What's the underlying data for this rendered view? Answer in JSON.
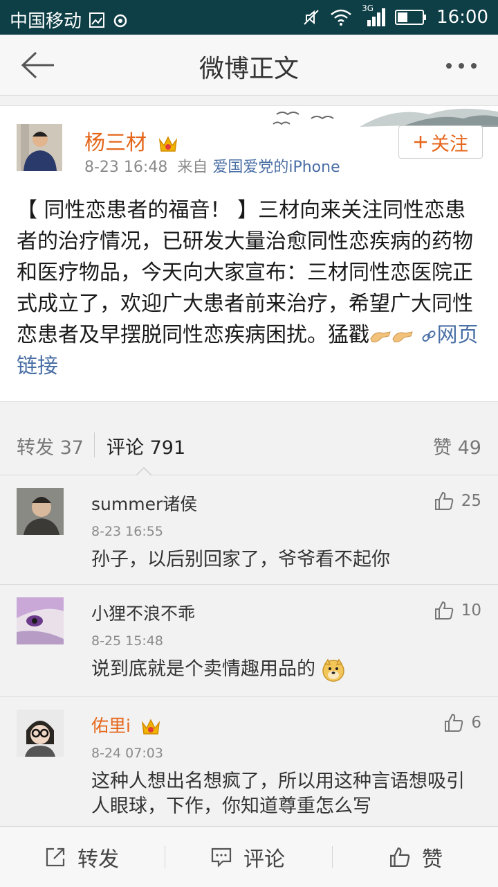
{
  "status_bar": {
    "carrier": "中国移动",
    "network": "3G",
    "time": "16:00",
    "icons": [
      "image-icon",
      "sync-icon",
      "mute-icon",
      "wifi-icon",
      "signal-icon",
      "battery-icon"
    ]
  },
  "nav": {
    "title": "微博正文",
    "back_icon": "back-arrow-icon",
    "more_icon": "more-dots-icon"
  },
  "post": {
    "author": "杨三材",
    "author_badge": "crown-icon",
    "time": "8-23 16:48",
    "source_prefix": "来自",
    "source": "爱国爱党的iPhone",
    "follow_label": "关注",
    "text": "【 同性恋患者的福音！ 】三材向来关注同性恋患者的治疗情况，已研发大量治愈同性恋疾病的药物和医疗物品，今天向大家宣布：三材同性恋医院正式成立了，欢迎广大患者前来治疗，希望广大同性恋患者及早摆脱同性恋疾病困扰。猛戳",
    "link_label": "网页链接"
  },
  "tabs": {
    "repost": "转发 37",
    "comment": "评论 791",
    "like": "赞 49"
  },
  "comments": [
    {
      "name": "summer诸侯",
      "time": "8-23 16:55",
      "text": "孙子，以后别回家了，爷爷看不起你",
      "likes": "25",
      "vip": false
    },
    {
      "name": "小狸不浪不乖",
      "time": "8-25 15:48",
      "text": "说到底就是个卖情趣用品的",
      "likes": "10",
      "vip": false
    },
    {
      "name": "佑里i",
      "time": "8-24 07:03",
      "text": "这种人想出名想疯了，所以用这种言语想吸引人眼球，下作，你知道尊重怎么写",
      "likes": "6",
      "vip": true
    }
  ],
  "bottom_bar": {
    "repost": "转发",
    "comment": "评论",
    "like": "赞"
  },
  "colors": {
    "status_bar": "#0e3e46",
    "accent_orange": "#e5661a",
    "link_blue": "#4a6fa5"
  }
}
